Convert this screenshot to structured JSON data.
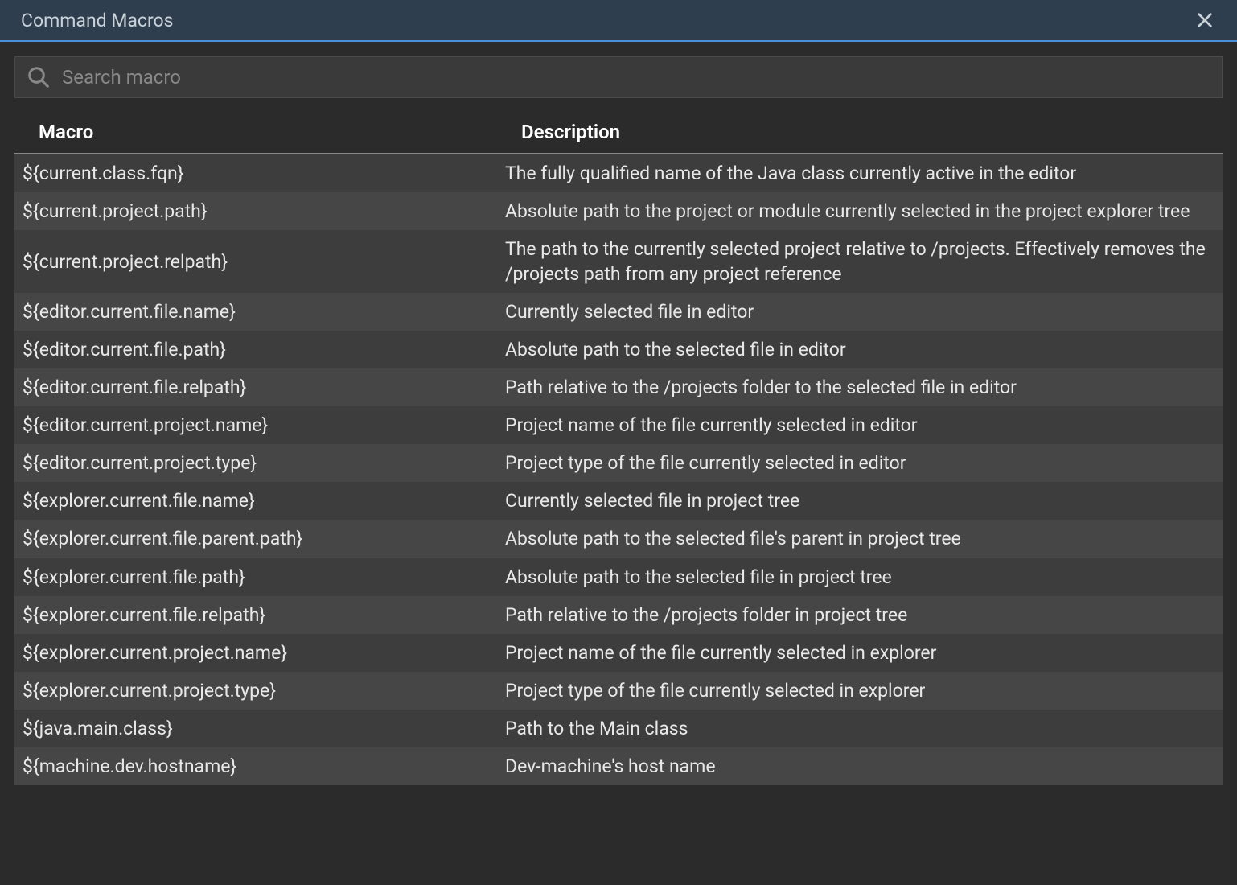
{
  "dialog": {
    "title": "Command Macros",
    "search_placeholder": "Search macro"
  },
  "table": {
    "headers": {
      "macro": "Macro",
      "description": "Description"
    },
    "rows": [
      {
        "macro": "${current.class.fqn}",
        "description": "The fully qualified name of the Java class currently active in the editor"
      },
      {
        "macro": "${current.project.path}",
        "description": "Absolute path to the project or module currently selected in the project explorer tree"
      },
      {
        "macro": "${current.project.relpath}",
        "description": "The path to the currently selected project relative to /projects. Effectively removes the /projects path from any project reference"
      },
      {
        "macro": "${editor.current.file.name}",
        "description": "Currently selected file in editor"
      },
      {
        "macro": "${editor.current.file.path}",
        "description": "Absolute path to the selected file in editor"
      },
      {
        "macro": "${editor.current.file.relpath}",
        "description": "Path relative to the /projects folder to the selected file in editor"
      },
      {
        "macro": "${editor.current.project.name}",
        "description": "Project name of the file currently selected in editor"
      },
      {
        "macro": "${editor.current.project.type}",
        "description": "Project type of the file currently selected in editor"
      },
      {
        "macro": "${explorer.current.file.name}",
        "description": "Currently selected file in project tree"
      },
      {
        "macro": "${explorer.current.file.parent.path}",
        "description": "Absolute path to the selected file's parent in project tree"
      },
      {
        "macro": "${explorer.current.file.path}",
        "description": "Absolute path to the selected file in project tree"
      },
      {
        "macro": "${explorer.current.file.relpath}",
        "description": "Path relative to the /projects folder in project tree"
      },
      {
        "macro": "${explorer.current.project.name}",
        "description": "Project name of the file currently selected in explorer"
      },
      {
        "macro": "${explorer.current.project.type}",
        "description": "Project type of the file currently selected in explorer"
      },
      {
        "macro": "${java.main.class}",
        "description": "Path to the Main class"
      },
      {
        "macro": "${machine.dev.hostname}",
        "description": "Dev-machine's host name"
      }
    ]
  }
}
